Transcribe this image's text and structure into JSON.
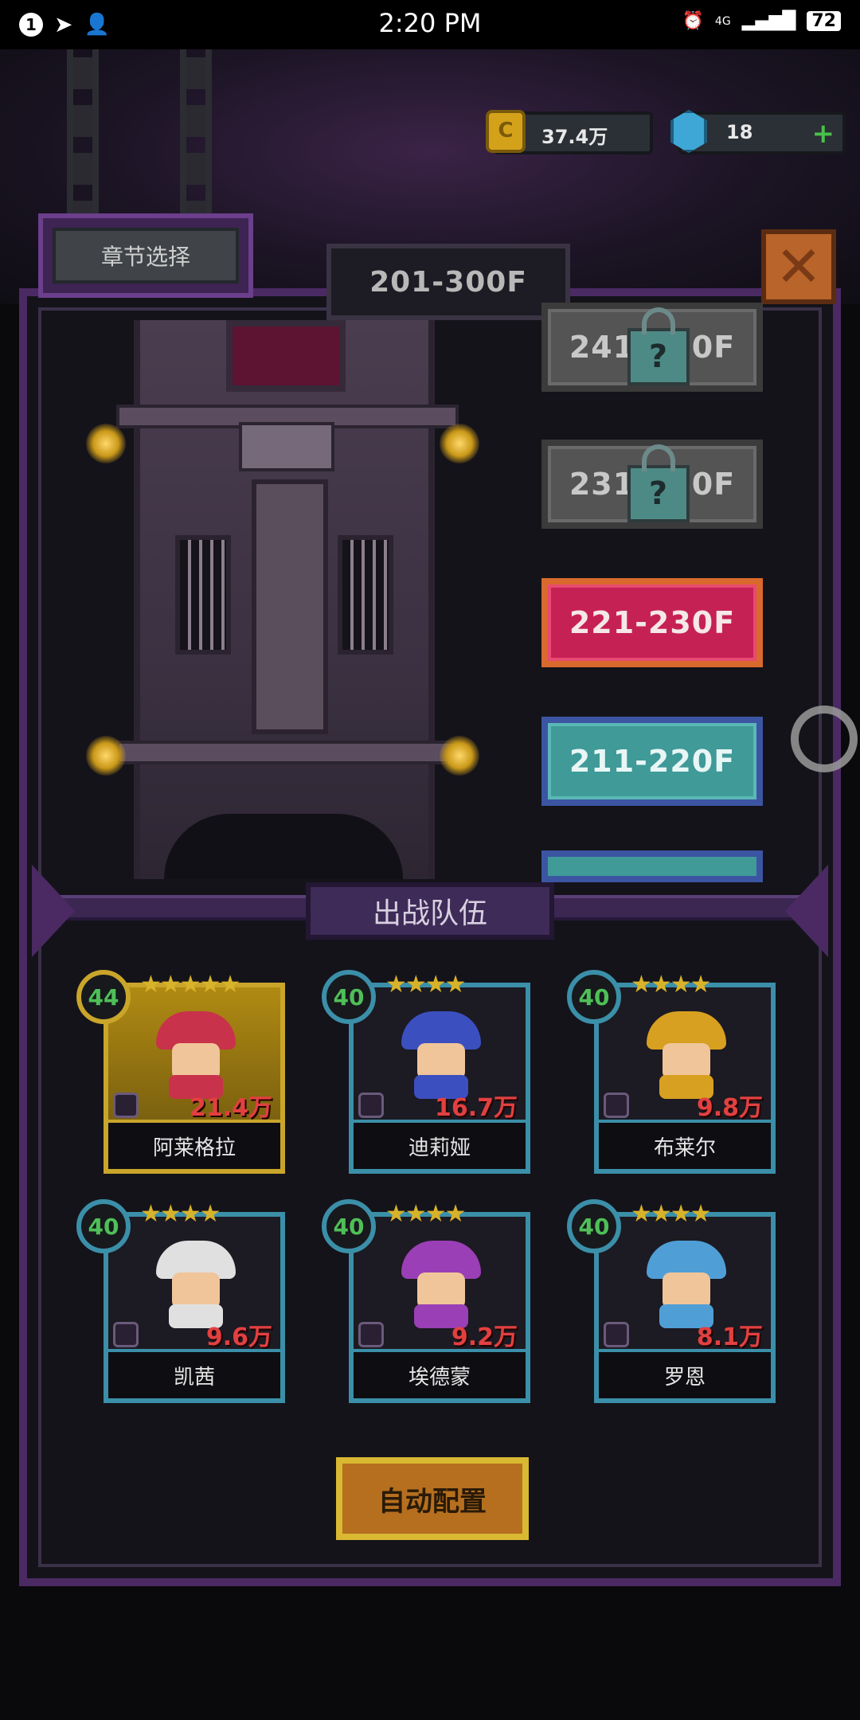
{
  "status_bar": {
    "notification_count": "1",
    "time": "2:20 PM",
    "network": "4G",
    "battery": "72"
  },
  "currency": {
    "coins": "37.4万",
    "gems": "18",
    "gem_plus": "+"
  },
  "header": {
    "chapter_select": "章节选择",
    "floor_range": "201-300F",
    "close_symbol": "✕"
  },
  "floors": [
    {
      "label": "241-250F",
      "state": "locked"
    },
    {
      "label": "231-240F",
      "state": "locked"
    },
    {
      "label": "221-230F",
      "state": "current"
    },
    {
      "label": "211-220F",
      "state": "cleared"
    }
  ],
  "team": {
    "title": "出战队伍",
    "heroes": [
      {
        "name": "阿莱格拉",
        "level": "44",
        "stars": "★★★★★",
        "power": "21.4万",
        "color": "#c8324a",
        "rarity": "gold"
      },
      {
        "name": "迪莉娅",
        "level": "40",
        "stars": "★★★★",
        "power": "16.7万",
        "color": "#3b4fbf",
        "rarity": "blue"
      },
      {
        "name": "布莱尔",
        "level": "40",
        "stars": "★★★★",
        "power": "9.8万",
        "color": "#d8a020",
        "rarity": "blue"
      },
      {
        "name": "凯茜",
        "level": "40",
        "stars": "★★★★",
        "power": "9.6万",
        "color": "#e0e0e0",
        "rarity": "blue"
      },
      {
        "name": "埃德蒙",
        "level": "40",
        "stars": "★★★★",
        "power": "9.2万",
        "color": "#9a3fb5",
        "rarity": "blue"
      },
      {
        "name": "罗恩",
        "level": "40",
        "stars": "★★★★",
        "power": "8.1万",
        "color": "#4f9fd6",
        "rarity": "blue"
      }
    ],
    "auto_configure": "自动配置"
  }
}
